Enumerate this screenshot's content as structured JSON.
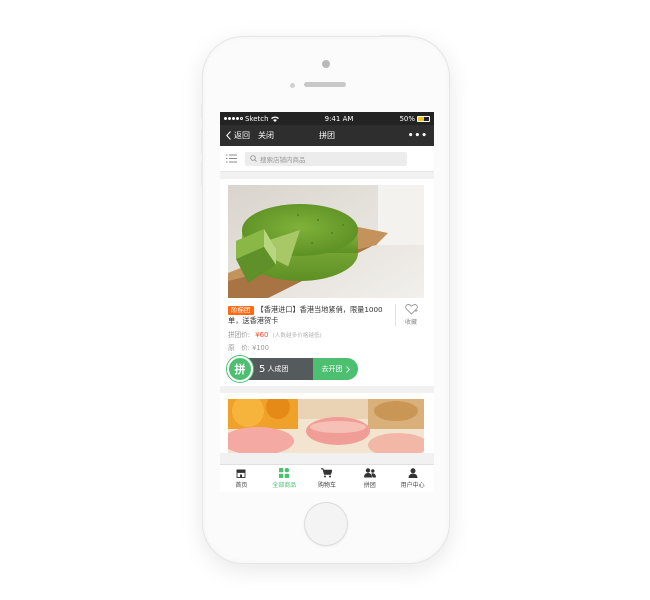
{
  "status_bar": {
    "carrier": "Sketch",
    "time": "9:41 AM",
    "battery": "50%"
  },
  "nav_bar": {
    "back_label": "返回",
    "close_label": "关闭",
    "title": "拼团",
    "more_label": "•••"
  },
  "search": {
    "placeholder": "搜索店铺内商品"
  },
  "product": {
    "tag": "阶梯团",
    "description": "【香港进口】香港当地紧俏，限量1000单，送香港贺卡",
    "favorite_label": "收藏",
    "group_price_label": "拼团价:",
    "group_price": "¥60",
    "group_price_note": "(人数越多价格越低)",
    "original_price_label": "原　价:",
    "original_price": "¥100",
    "badge_char": "拼",
    "group_count": "5",
    "group_count_suffix": "人成团",
    "open_group_label": "去开团"
  },
  "tab_bar": {
    "items": [
      {
        "label": "首页",
        "icon": "store-icon",
        "active": false
      },
      {
        "label": "全部商品",
        "icon": "grid-icon",
        "active": true
      },
      {
        "label": "购物车",
        "icon": "cart-icon",
        "active": false
      },
      {
        "label": "拼团",
        "icon": "group-icon",
        "active": false
      },
      {
        "label": "用户中心",
        "icon": "user-icon",
        "active": false
      }
    ]
  },
  "colors": {
    "accent_green": "#4cbf71",
    "tag_orange": "#ff6a12",
    "price_red": "#ff4a2a",
    "nav_dark": "#2e2e2e"
  }
}
